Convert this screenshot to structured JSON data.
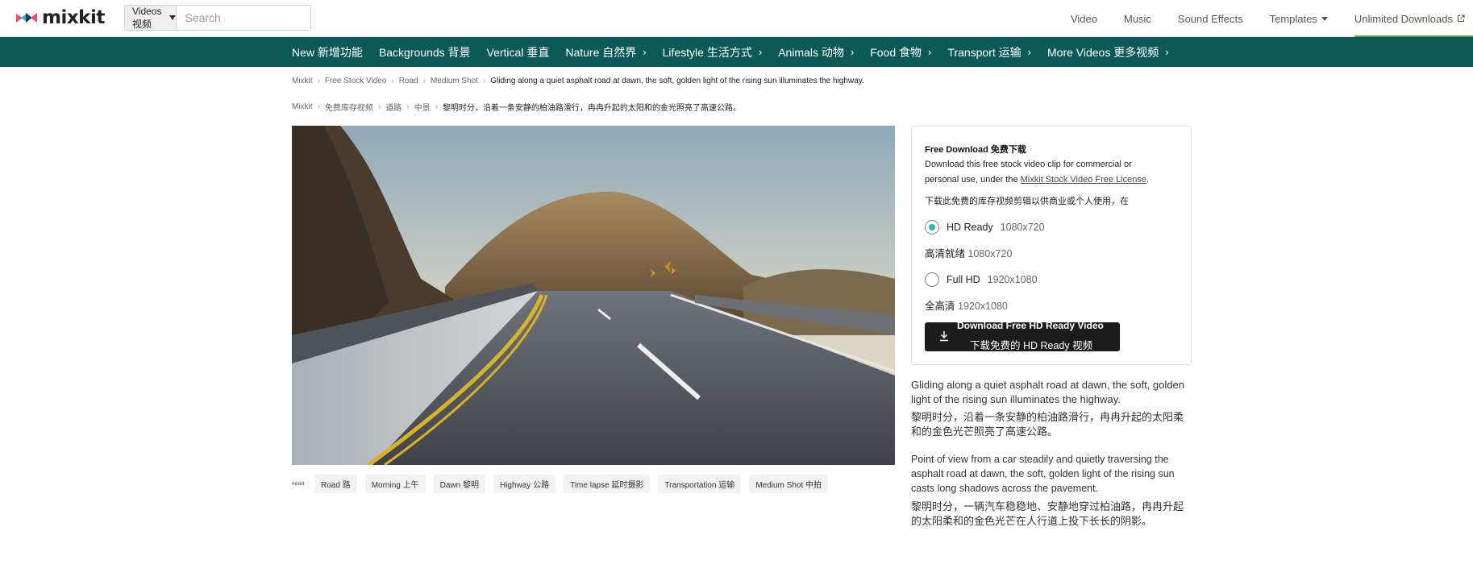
{
  "header": {
    "logo_text": "mixkit",
    "search_type": "Videos 视频",
    "search_placeholder": "Search",
    "nav": {
      "video": "Video",
      "music": "Music",
      "sound_effects": "Sound Effects",
      "templates": "Templates",
      "unlimited": "Unlimited Downloads"
    }
  },
  "categories": [
    {
      "label": "New 新增功能",
      "has_chevron": false
    },
    {
      "label": "Backgrounds 背景",
      "has_chevron": false
    },
    {
      "label": "Vertical 垂直",
      "has_chevron": false
    },
    {
      "label": "Nature 自然界",
      "has_chevron": true
    },
    {
      "label": "Lifestyle 生活方式",
      "has_chevron": true
    },
    {
      "label": "Animals 动物",
      "has_chevron": true
    },
    {
      "label": "Food 食物",
      "has_chevron": true
    },
    {
      "label": "Transport 运输",
      "has_chevron": true
    },
    {
      "label": "More Videos 更多视频",
      "has_chevron": true
    }
  ],
  "breadcrumb_en": {
    "items": [
      "Mixkit",
      "Free Stock Video",
      "Road",
      "Medium Shot"
    ],
    "current": "Gliding along a quiet asphalt road at dawn, the soft, golden light of the rising sun illuminates the highway."
  },
  "breadcrumb_zh": {
    "items": [
      "Mixkit",
      "免费库存视频",
      "道路",
      "中景"
    ],
    "current": "黎明时分，沿着一条安静的柏油路滑行，冉冉升起的太阳和的金光照亮了高速公路。"
  },
  "tags": {
    "logo_text": "mixkit",
    "items": [
      "Road 路",
      "Morning 上午",
      "Dawn 黎明",
      "Highway 公路",
      "Time lapse 延时摄影",
      "Transportation 运输",
      "Medium Shot 中拍"
    ]
  },
  "download": {
    "title": "Free Download 免费下载",
    "desc_prefix": "Download this free stock video clip for commercial or personal use, under the ",
    "license_link": "Mixkit Stock Video Free License",
    "desc_suffix": ".",
    "desc_zh": "下载此免费的库存视频剪辑以供商业或个人使用，在",
    "option_hd": {
      "label": "HD Ready",
      "res": "1080x720",
      "label_zh": "高清就绪",
      "selected": true
    },
    "option_fhd": {
      "label": "Full HD",
      "res": "1920x1080",
      "label_zh": "全高清",
      "selected": false
    },
    "button_line1": "Download Free HD Ready Video",
    "button_line2": "下载免费的 HD Ready 视频"
  },
  "description": {
    "en1": "Gliding along a quiet asphalt road at dawn, the soft, golden light of the rising sun illuminates the highway.",
    "zh1": "黎明时分，沿着一条安静的柏油路滑行，冉冉升起的太阳柔和的金色光芒照亮了高速公路。",
    "en2": "Point of view from a car steadily and quietly traversing the asphalt road at dawn, the soft, golden light of the rising sun casts long shadows across the pavement.",
    "zh2": "黎明时分，一辆汽车稳稳地、安静地穿过柏油路，冉冉升起的太阳柔和的金色光芒在人行道上投下长长的阴影。"
  },
  "colors": {
    "category_bar": "#0c5a58",
    "accent_underline": "#4caf50",
    "radio_selected": "#2eb8b0",
    "button_bg": "#1c1c1c"
  }
}
